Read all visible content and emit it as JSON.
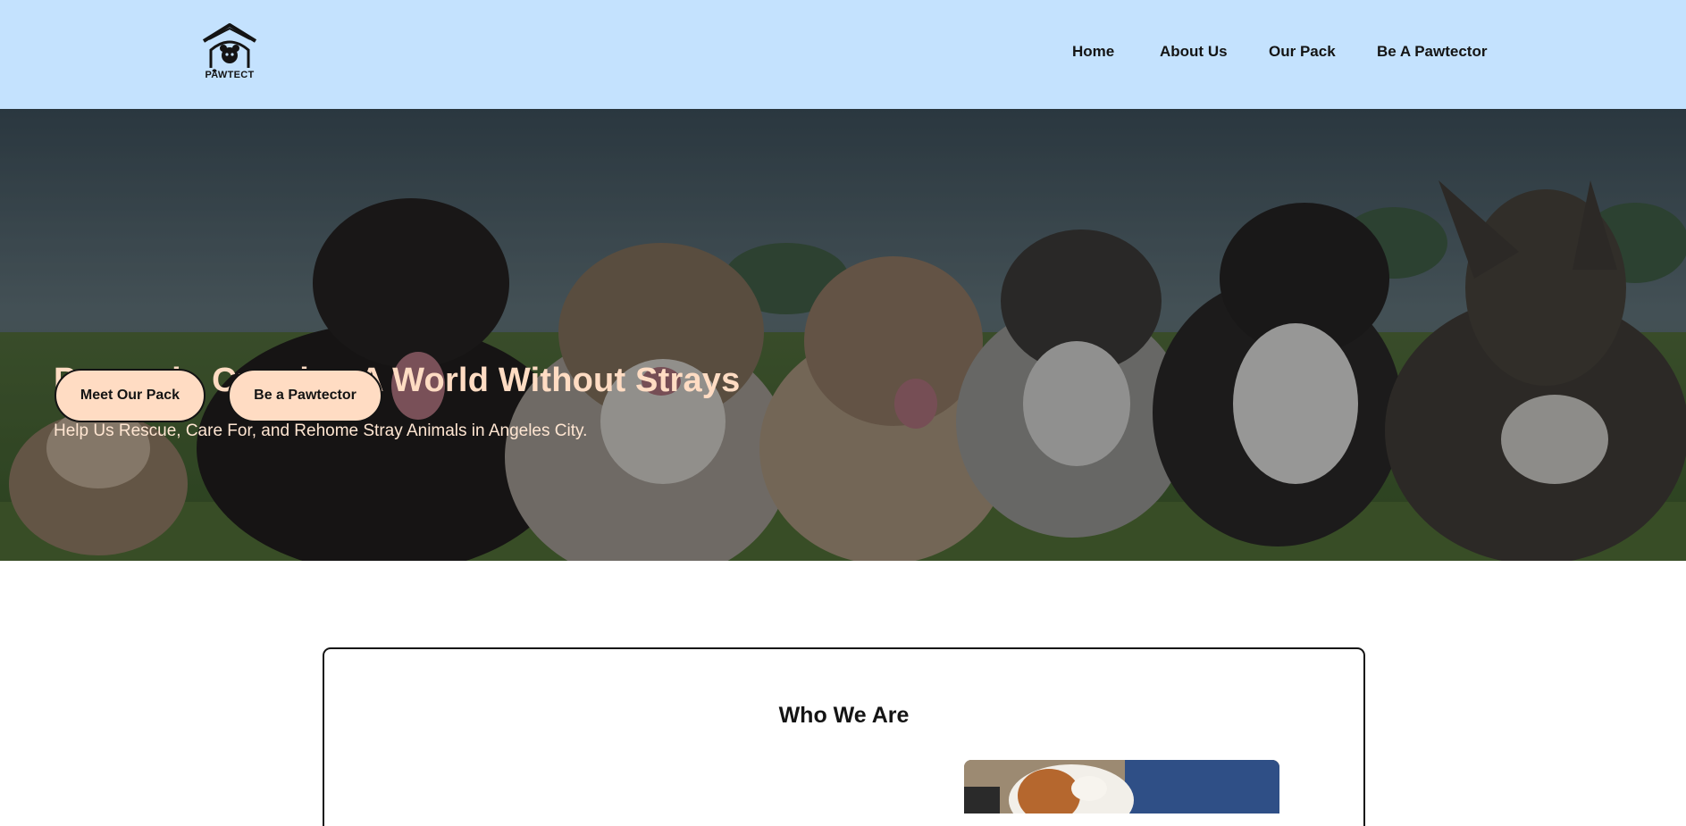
{
  "header": {
    "logo_text": "PAWTECT",
    "nav": [
      {
        "label": "Home"
      },
      {
        "label": "About Us"
      },
      {
        "label": "Our Pack"
      },
      {
        "label": "Be A Pawtector"
      }
    ]
  },
  "hero": {
    "title": "Pawtech, Creating A World Without Strays",
    "subtitle": "Help Us Rescue, Care For, and Rehome Stray Animals in Angeles City.",
    "buttons": [
      {
        "label": "Meet Our Pack"
      },
      {
        "label": "Be a Pawtector"
      }
    ]
  },
  "about": {
    "title": "Who We Are"
  },
  "colors": {
    "header_bg": "#c4e2fe",
    "accent": "#ffdcc3",
    "text_dark": "#141414"
  },
  "icons": {
    "logo": "house-dog-logo-icon"
  }
}
